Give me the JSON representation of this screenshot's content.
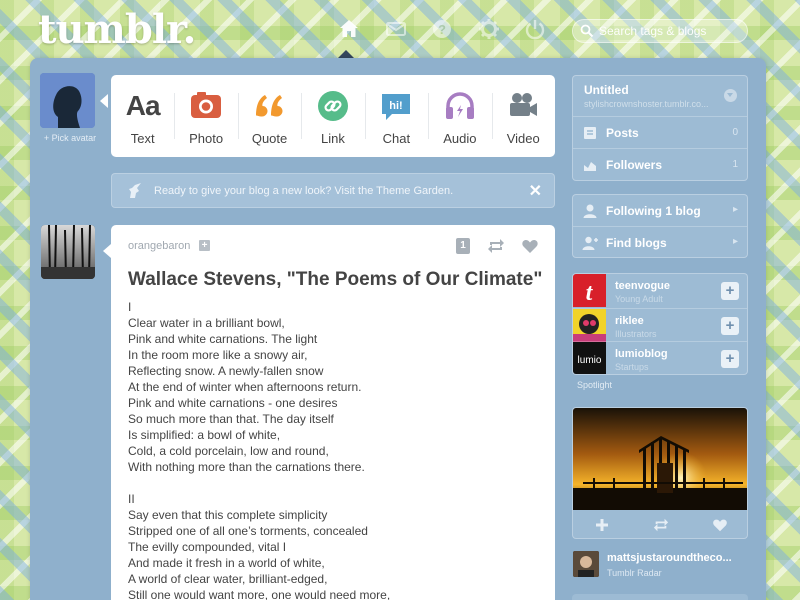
{
  "header": {
    "logo": "tumblr.",
    "search_placeholder": "Search tags & blogs",
    "nav": [
      "home-icon",
      "mail-icon",
      "help-icon",
      "settings-icon",
      "power-icon"
    ]
  },
  "composer": {
    "pick_avatar": "+ Pick avatar",
    "aa_glyph": "Aa",
    "types": [
      {
        "label": "Text",
        "icon": "text-icon",
        "color": "#444444"
      },
      {
        "label": "Photo",
        "icon": "camera-icon",
        "color": "#d95e40"
      },
      {
        "label": "Quote",
        "icon": "quote-icon",
        "color": "#f2992e"
      },
      {
        "label": "Link",
        "icon": "link-icon",
        "color": "#56bc8a"
      },
      {
        "label": "Chat",
        "icon": "chat-icon",
        "color": "#529ecc"
      },
      {
        "label": "Audio",
        "icon": "headphones-icon",
        "color": "#a77dc2"
      },
      {
        "label": "Video",
        "icon": "video-camera-icon",
        "color": "#748089"
      }
    ],
    "chat_glyph": "hi!"
  },
  "theme_banner": {
    "text": "Ready to give your blog a new look? Visit the Theme Garden.",
    "close": "✕"
  },
  "post": {
    "author": "orangebaron",
    "follow_glyph": "+",
    "note_count": "1",
    "title": "Wallace Stevens, \"The Poems of Our Climate\"",
    "lines": [
      "I",
      "Clear water in a brilliant bowl,",
      "Pink and white carnations. The light",
      "In the room more like a snowy air,",
      "Reflecting snow. A newly-fallen snow",
      "At the end of winter when afternoons return.",
      "Pink and white carnations - one desires",
      "So much more than that. The day itself",
      "Is simplified: a bowl of white,",
      "Cold, a cold porcelain, low and round,",
      "With nothing more than the carnations there.",
      "",
      "II",
      "Say even that this complete simplicity",
      "Stripped one of all one’s torments, concealed",
      "The evilly compounded, vital I",
      "And made it fresh in a world of white,",
      "A world of clear water, brilliant-edged,",
      "Still one would want more, one would need more,"
    ]
  },
  "sidebar": {
    "blog": {
      "title": "Untitled",
      "url": "stylishcrownshoster.tumblr.co..."
    },
    "blog_rows": [
      {
        "label": "Posts",
        "count": "0",
        "icon": "posts-icon"
      },
      {
        "label": "Followers",
        "count": "1",
        "icon": "followers-icon"
      }
    ],
    "nav_rows": [
      {
        "label": "Following 1 blog",
        "arrow": "▸",
        "icon": "following-icon"
      },
      {
        "label": "Find blogs",
        "arrow": "▸",
        "icon": "find-blogs-icon"
      }
    ],
    "recommended": [
      {
        "name": "teenvogue",
        "category": "Young Adult",
        "thumb_text": "t"
      },
      {
        "name": "riklee",
        "category": "Illustrators",
        "thumb_text": ""
      },
      {
        "name": "lumioblog",
        "category": "Startups",
        "thumb_text": "lumio"
      }
    ],
    "follow_glyph": "+",
    "spotlight": "Spotlight",
    "radar": {
      "user": "mattsjustaroundtheco...",
      "label": "Tumblr Radar"
    }
  },
  "colors": {
    "panel": "#8fb0cc",
    "sidebar_box": "#9dbbd4",
    "navy": "#34465d"
  }
}
